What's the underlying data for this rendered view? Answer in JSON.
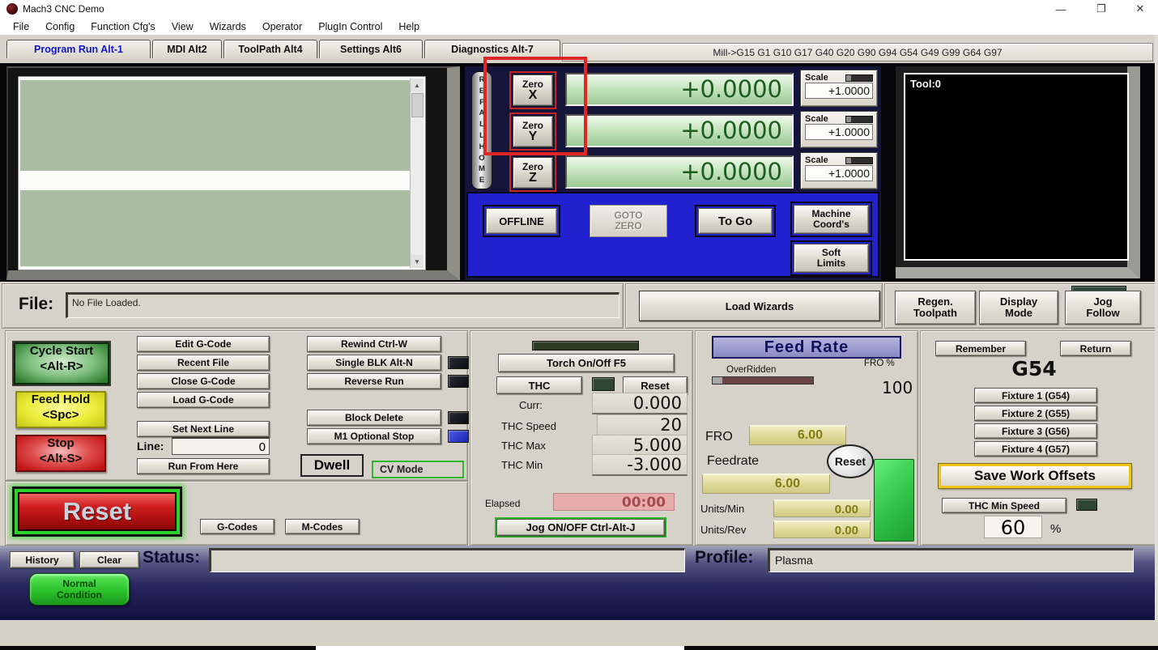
{
  "window": {
    "title": "Mach3 CNC  Demo",
    "icons": {
      "minimize": "—",
      "restore": "❐",
      "close": "✕"
    }
  },
  "menu": {
    "items": [
      "File",
      "Config",
      "Function Cfg's",
      "View",
      "Wizards",
      "Operator",
      "PlugIn Control",
      "Help"
    ]
  },
  "tabs": [
    {
      "label": "Program Run Alt-1"
    },
    {
      "label": "MDI Alt2"
    },
    {
      "label": "ToolPath Alt4"
    },
    {
      "label": "Settings Alt6"
    },
    {
      "label": "Diagnostics Alt-7"
    }
  ],
  "header": {
    "gcode_modes": "Mill->G15  G1 G10 G17 G40 G20 G90 G94 G54 G49 G99 G64 G97"
  },
  "gcode_window": {
    "scroll_up": "▲",
    "scroll_down": "▼"
  },
  "dro": {
    "ref_letters": [
      "R",
      "E",
      "F",
      "A",
      "L",
      "L",
      "H",
      "O",
      "M",
      "E"
    ],
    "axes": [
      {
        "zero_line1": "Zero",
        "zero_line2": "X",
        "value": "+0.0000",
        "scale_label": "Scale",
        "scale_value": "+1.0000"
      },
      {
        "zero_line1": "Zero",
        "zero_line2": "Y",
        "value": "+0.0000",
        "scale_label": "Scale",
        "scale_value": "+1.0000"
      },
      {
        "zero_line1": "Zero",
        "zero_line2": "Z",
        "value": "+0.0000",
        "scale_label": "Scale",
        "scale_value": "+1.0000"
      }
    ],
    "buttons": {
      "offline": "OFFLINE",
      "goto_line1": "GOTO",
      "goto_line2": "ZERO",
      "to_go": "To Go",
      "machine_line1": "Machine",
      "machine_line2": "Coord's",
      "soft_line1": "Soft",
      "soft_line2": "Limits"
    }
  },
  "toolpath": {
    "tool_label": "Tool:0",
    "regen_line1": "Regen.",
    "regen_line2": "Toolpath",
    "display_line1": "Display",
    "display_line2": "Mode",
    "jog_line1": "Jog",
    "jog_line2": "Follow"
  },
  "file": {
    "label": "File:",
    "value": "No File Loaded.",
    "load_wizards": "Load Wizards"
  },
  "program": {
    "cycle_line1": "Cycle Start",
    "cycle_line2": "<Alt-R>",
    "hold_line1": "Feed Hold",
    "hold_line2": "<Spc>",
    "stop_line1": "Stop",
    "stop_line2": "<Alt-S>"
  },
  "gcode_actions": {
    "edit": "Edit G-Code",
    "recent": "Recent File",
    "close": "Close G-Code",
    "load": "Load G-Code",
    "set_next": "Set Next Line",
    "line_label": "Line:",
    "line_value": "0",
    "run_from_here": "Run From Here"
  },
  "run_options": {
    "rewind": "Rewind Ctrl-W",
    "single_blk": "Single BLK Alt-N",
    "reverse": "Reverse Run",
    "block_delete": "Block Delete",
    "m1_stop": "M1 Optional Stop",
    "dwell": "Dwell",
    "cv_mode": "CV Mode"
  },
  "reset_area": {
    "reset": "Reset",
    "g_codes": "G-Codes",
    "m_codes": "M-Codes"
  },
  "torch": {
    "torch_btn": "Torch On/Off F5",
    "thc_btn": "THC",
    "reset_btn": "Reset",
    "curr_label": "Curr:",
    "curr_value": "0.000",
    "speed_label": "THC Speed",
    "speed_value": "20",
    "max_label": "THC Max",
    "max_value": "5.000",
    "min_label": "THC Min",
    "min_value": "-3.000",
    "elapsed_label": "Elapsed",
    "elapsed_value": "00:00",
    "jog_btn": "Jog ON/OFF Ctrl-Alt-J"
  },
  "feed_rate": {
    "title": "Feed Rate",
    "overridden_label": "OverRidden",
    "fro_pct_label": "FRO %",
    "fro_pct_value": "100",
    "fro_label": "FRO",
    "fro_value": "6.00",
    "feedrate_label": "Feedrate",
    "reset_btn": "Reset",
    "feedrate_value": "6.00",
    "units_min_label": "Units/Min",
    "units_min_value": "0.00",
    "units_rev_label": "Units/Rev",
    "units_rev_value": "0.00"
  },
  "offsets": {
    "remember": "Remember",
    "return": "Return",
    "current": "G54",
    "fixtures": [
      "Fixture 1 (G54)",
      "Fixture 2 (G55)",
      "Fixture 3 (G56)",
      "Fixture 4 (G57)"
    ],
    "save": "Save Work Offsets",
    "thc_min_speed": "THC Min Speed",
    "thc_min_value": "60",
    "percent": "%"
  },
  "status_bar": {
    "history": "History",
    "clear": "Clear",
    "status_label": "Status:",
    "status_value": "",
    "profile_label": "Profile:",
    "profile_value": "Plasma",
    "normal_line1": "Normal",
    "normal_line2": "Condition"
  },
  "colors": {
    "annotation_red": "#e02525",
    "dro_text_green": "#1d5e20",
    "panel_blue": "#2121d0",
    "list_green": "#a9bda2",
    "reset_red": "#c01010",
    "glow_green": "#2ed22e",
    "led_blue": "#2636d6",
    "led_dark_green": "#2e4632",
    "value_yellow": "#ded898",
    "elapsed_pink": "#e9acac"
  }
}
